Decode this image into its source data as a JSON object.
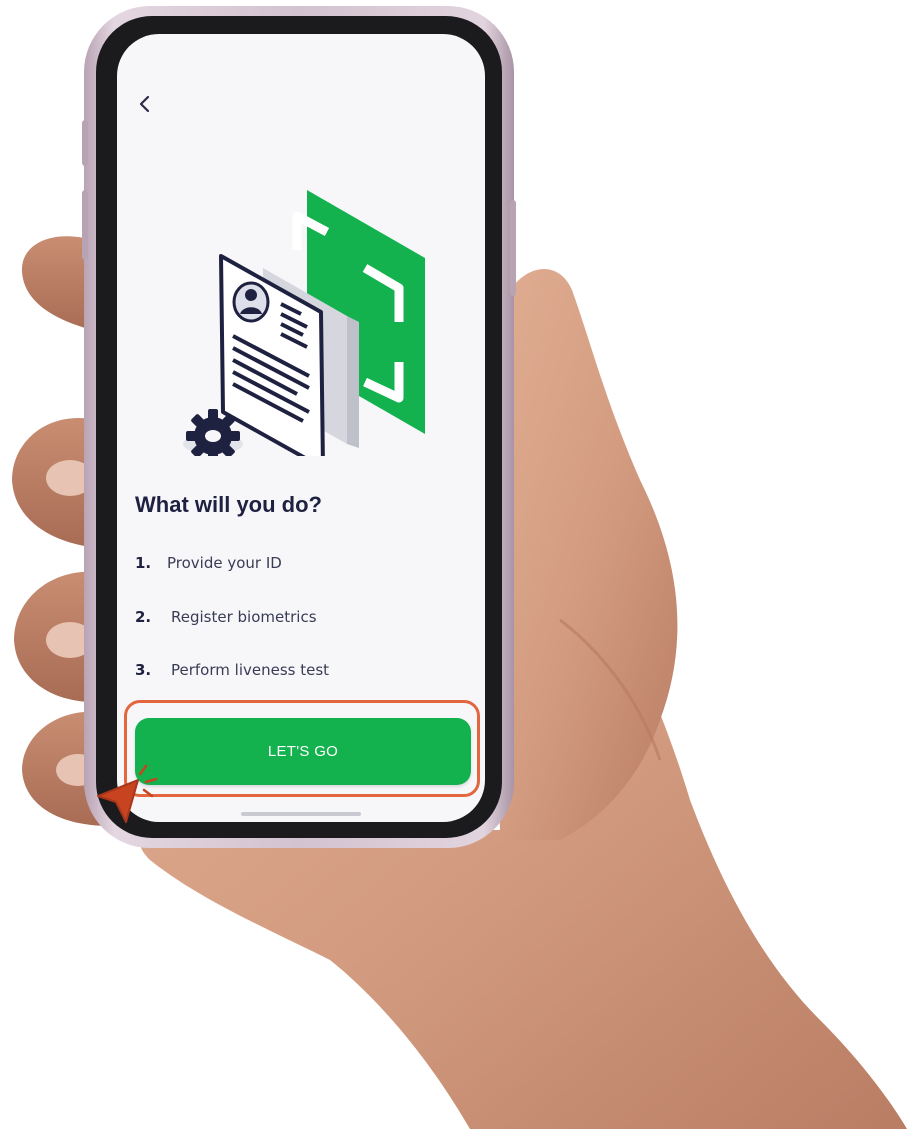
{
  "screen": {
    "back_icon": "chevron-left-icon",
    "illustration_icon": "id-card-scan-icon",
    "heading": "What will you do?",
    "steps": [
      {
        "number": "1.",
        "label": "Provide your ID"
      },
      {
        "number": "2.",
        "label": "Register biometrics"
      },
      {
        "number": "3.",
        "label": "Perform liveness test"
      }
    ],
    "cta_label": "LET'S GO"
  },
  "colors": {
    "accent_green": "#13b24f",
    "heading_navy": "#1f2140",
    "highlight_orange": "#e2673f",
    "screen_background": "#f7f7fa"
  }
}
